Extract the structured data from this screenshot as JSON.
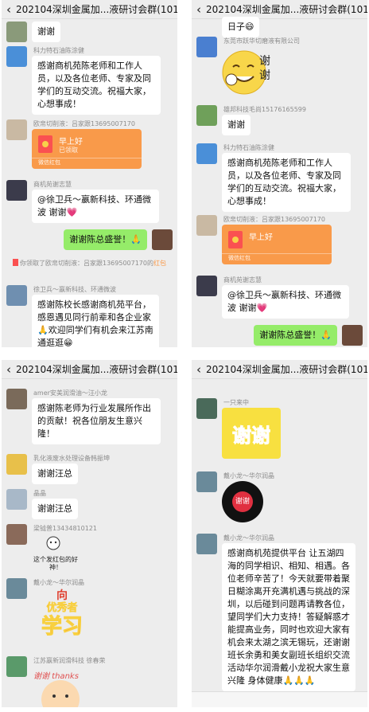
{
  "group_title": "202104深圳金属加...液研讨会群(101)",
  "panel1": {
    "m0": {
      "text": "谢谢"
    },
    "m1": {
      "name": "科力特石油陈涂健",
      "text": "感谢商机苑陈老师和工作人员，以及各位老师、专家及同学们的互动交流。祝福大家，心想事成！"
    },
    "m2": {
      "name": "欧帛切削液：吕家跟13695007170",
      "packet_title": "早上好",
      "packet_status": "已领取",
      "packet_label": "微信红包"
    },
    "m3": {
      "name": "商机苑谢志慧",
      "text": "@徐卫兵～嬴新科技、环通微波  谢谢💗"
    },
    "m4": {
      "text": "谢谢陈总盛誉！🙏"
    },
    "system": {
      "prefix": "你领取了欧帛切削液：吕家跟13695007170的",
      "link": "红包"
    },
    "m5": {
      "name": "徐卫兵～嬴新科技、环通微波",
      "text": "感谢陈校长感谢商机苑平台，感恩遇见同行前辈和各企业家🙏欢迎同学们有机会来江苏南通逛逛😁"
    }
  },
  "panel2": {
    "m0": {
      "text": "日子😄"
    },
    "m1": {
      "name": "东莞市跃华切磨液有限公司",
      "sticker_text": "谢谢"
    },
    "m2": {
      "name": "雄邦科技毛尚15176165599",
      "text": "谢谢"
    },
    "m3": {
      "name": "科力特石油陈涂健",
      "text": "感谢商机苑陈老师和工作人员，以及各位老师、专家及同学们的互动交流。祝福大家，心想事成！"
    },
    "m4": {
      "name": "欧帛切削液：吕家跟13695007170",
      "packet_title": "早上好",
      "packet_label": "微信红包"
    },
    "m5": {
      "name": "商机苑谢志慧",
      "text": "@徐卫兵～嬴新科技、环通微波  谢谢💗"
    },
    "m6": {
      "text": "谢谢陈总盛誉！🙏"
    }
  },
  "panel3": {
    "m1": {
      "name": "amer安美润滑油～汪小龙",
      "text": "感谢陈老师为行业发展所作出的贡献！祝各位朋友生意兴隆！"
    },
    "m2": {
      "name": "乳化液废水处理设备韩振坤",
      "text": "谢谢汪总"
    },
    "m3": {
      "name": "晶晶",
      "text": "谢谢汪总"
    },
    "m4": {
      "name": "梁钺普13434810121",
      "sticker_text": "这个发红包的好神！"
    },
    "m5": {
      "name": "戴小龙～华尔润晶",
      "sticker_line1": "向",
      "sticker_line2": "优秀者",
      "sticker_line3": "学习"
    },
    "m6": {
      "name": "江苏嬴新润滑科技  徐春荣",
      "sticker_text": "谢谢 thanks"
    }
  },
  "panel4": {
    "m1": {
      "name": "一只来中",
      "sticker_text": "谢谢"
    },
    "m2": {
      "name": "戴小龙～华尔润晶",
      "sticker_text": "谢谢"
    },
    "m3": {
      "name": "戴小龙～华尔润晶",
      "text": "感谢商机苑提供平台 让五湖四海的同学相识、相知、相遇。各位老师辛苦了！今天就要带着聚日糊涂离开充满机遇与挑战的深圳，以后碰到问题再请教各位，望同学们大力支持！答疑解惑才能提高业务，同时也欢迎大家有机会来太湖之滨无锡玩，还谢谢班长余勇和美女副班长组织交流活动华尔润滑戴小龙祝大家生意兴隆 身体健康🙏🙏🙏"
    }
  },
  "colors": {
    "chat_bg": "#ededed",
    "self_bubble": "#95ec69",
    "red_packet": "#f99a4a"
  },
  "icons": {
    "back": "‹"
  }
}
